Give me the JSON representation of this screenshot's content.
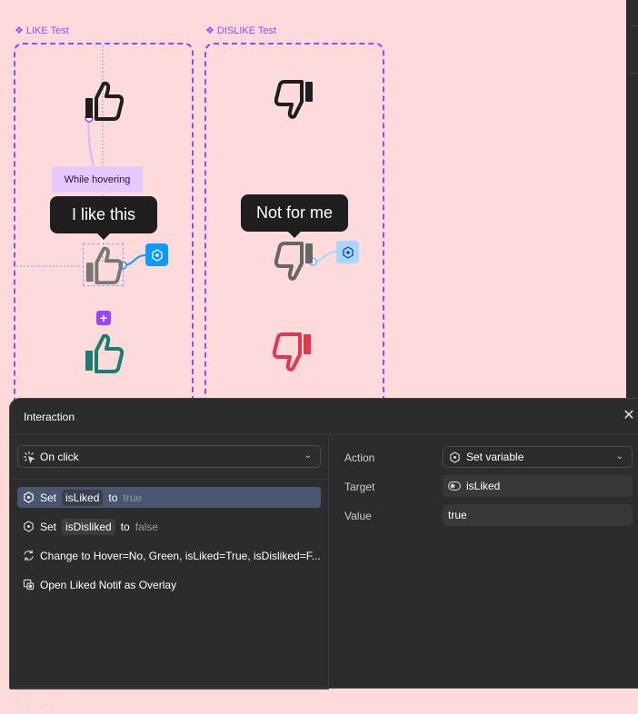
{
  "canvas": {
    "like_frame_label": "LIKE Test",
    "dislike_frame_label": "DISLIKE Test",
    "hover_chip": "While hovering",
    "like_tooltip": "I like this",
    "dislike_tooltip": "Not for me",
    "colors": {
      "background": "#fddbdb",
      "frame_border": "#9747ff",
      "thumb_default": "#1e1e1e",
      "thumb_hover": "#777777",
      "thumb_liked": "#1b7d72",
      "thumb_disliked": "#e0384f",
      "proto_node_active": "#0d99ff",
      "proto_node_idle": "#a9d6ff"
    }
  },
  "panel": {
    "title": "Interaction",
    "close_icon": "close-icon",
    "trigger": {
      "label": "On click",
      "icon": "click-trigger-icon"
    },
    "actions": [
      {
        "verb": "Set",
        "variable": "isLiked",
        "to": "to",
        "value": "true",
        "selected": true
      },
      {
        "verb": "Set",
        "variable": "isDisliked",
        "to": "to",
        "value": "false",
        "selected": false
      },
      {
        "text": "Change to Hover=No, Green, isLiked=True, isDisliked=F..."
      },
      {
        "text": "Open Liked Notif as Overlay"
      }
    ],
    "footer": {
      "add": "+",
      "remove": "—"
    },
    "properties": {
      "action_label": "Action",
      "action_value": "Set variable",
      "target_label": "Target",
      "target_value": "isLiked",
      "value_label": "Value",
      "value_value": "true"
    }
  }
}
